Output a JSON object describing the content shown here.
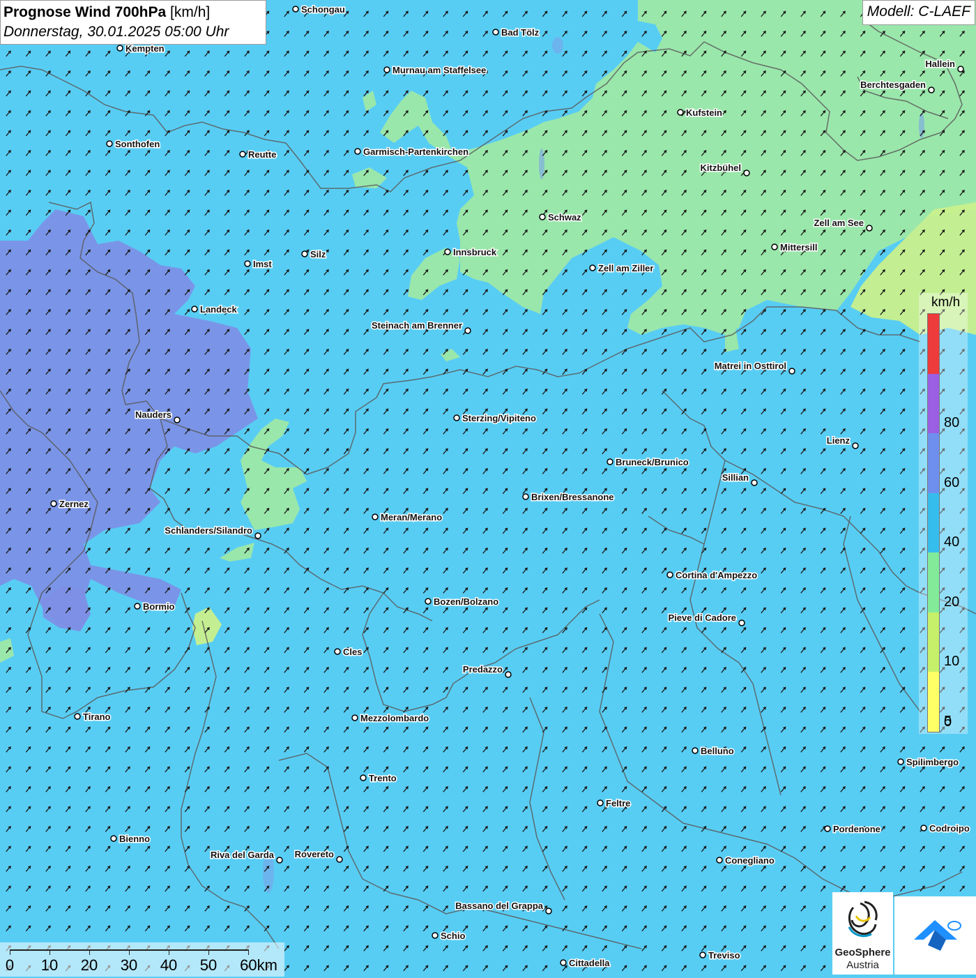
{
  "header": {
    "title_bold": "Prognose Wind 700hPa",
    "title_unit": "[km/h]",
    "datetime": "Donnerstag, 30.01.2025 05:00 Uhr"
  },
  "model": {
    "label": "Modell: C-LAEF"
  },
  "legend": {
    "unit": "km/h",
    "bins": [
      {
        "label": "",
        "color": "#ee3b3b"
      },
      {
        "label": "80",
        "color": "#9b5fe3"
      },
      {
        "label": "60",
        "color": "#6f8fef"
      },
      {
        "label": "40",
        "color": "#35bdee"
      },
      {
        "label": "20",
        "color": "#82eb9a"
      },
      {
        "label": "10",
        "color": "#c6f06a"
      },
      {
        "label": "5",
        "color": "#ffff66"
      }
    ],
    "bottom_label": "0"
  },
  "scale_bar": {
    "labels": [
      "0",
      "10",
      "20",
      "30",
      "40",
      "50",
      "60km"
    ]
  },
  "logos": {
    "geosphere_line1": "GeoSphere",
    "geosphere_line2": "Austria",
    "geosphere_icon": "geosphere-logo-icon",
    "app_icon": "wetter-app-logo-icon"
  },
  "colors": {
    "wind_20_40": "#58cdf4",
    "wind_10_20": "#9ee8a6",
    "wind_5_10": "#c9f08c",
    "wind_40_60": "#7c8fe6",
    "border": "#555555",
    "arrow": "#1a1a1a"
  },
  "cities": [
    {
      "name": "Schongau",
      "label_side": "right"
    },
    {
      "name": "Bad Tölz",
      "label_side": "right"
    },
    {
      "name": "Kempten",
      "label_side": "right"
    },
    {
      "name": "Murnau am Staffelsee",
      "label_side": "right"
    },
    {
      "name": "Hallein",
      "label_side": "left"
    },
    {
      "name": "Berchtesgaden",
      "label_side": "left"
    },
    {
      "name": "Kufstein",
      "label_side": "right"
    },
    {
      "name": "Sonthofen",
      "label_side": "right"
    },
    {
      "name": "Reutte",
      "label_side": "right"
    },
    {
      "name": "Garmisch-Partenkirchen",
      "label_side": "right"
    },
    {
      "name": "Kitzbühel",
      "label_side": "left"
    },
    {
      "name": "Schwaz",
      "label_side": "right"
    },
    {
      "name": "Zell am See",
      "label_side": "left"
    },
    {
      "name": "Innsbruck",
      "label_side": "right"
    },
    {
      "name": "Mittersill",
      "label_side": "right"
    },
    {
      "name": "Silz",
      "label_side": "right"
    },
    {
      "name": "Imst",
      "label_side": "right"
    },
    {
      "name": "Zell am Ziller",
      "label_side": "right"
    },
    {
      "name": "Landeck",
      "label_side": "right"
    },
    {
      "name": "Steinach am Brenner",
      "label_side": "left"
    },
    {
      "name": "Matrei in Osttirol",
      "label_side": "left"
    },
    {
      "name": "Nauders",
      "label_side": "left"
    },
    {
      "name": "Sterzing/Vipiteno",
      "label_side": "right"
    },
    {
      "name": "Lienz",
      "label_side": "left"
    },
    {
      "name": "Bruneck/Brunico",
      "label_side": "right"
    },
    {
      "name": "Sillian",
      "label_side": "left"
    },
    {
      "name": "Brixen/Bressanone",
      "label_side": "right"
    },
    {
      "name": "Zernez",
      "label_side": "right"
    },
    {
      "name": "Meran/Merano",
      "label_side": "right"
    },
    {
      "name": "Schlanders/Silandro",
      "label_side": "left"
    },
    {
      "name": "Cortina d'Ampezzo",
      "label_side": "right"
    },
    {
      "name": "Bozen/Bolzano",
      "label_side": "right"
    },
    {
      "name": "Bormio",
      "label_side": "right"
    },
    {
      "name": "Pieve di Cadore",
      "label_side": "left"
    },
    {
      "name": "Cles",
      "label_side": "right"
    },
    {
      "name": "Predazzo",
      "label_side": "left"
    },
    {
      "name": "Tirano",
      "label_side": "right"
    },
    {
      "name": "Mezzolombardo",
      "label_side": "right"
    },
    {
      "name": "Belluno",
      "label_side": "right"
    },
    {
      "name": "Spilimbergo",
      "label_side": "right"
    },
    {
      "name": "Trento",
      "label_side": "right"
    },
    {
      "name": "Feltre",
      "label_side": "right"
    },
    {
      "name": "Pordenone",
      "label_side": "right"
    },
    {
      "name": "Codroipo",
      "label_side": "right"
    },
    {
      "name": "Bienno",
      "label_side": "right"
    },
    {
      "name": "Riva del Garda",
      "label_side": "left"
    },
    {
      "name": "Rovereto",
      "label_side": "left"
    },
    {
      "name": "Conegliano",
      "label_side": "right"
    },
    {
      "name": "Bassano del Grappa",
      "label_side": "left"
    },
    {
      "name": "Schio",
      "label_side": "right"
    },
    {
      "name": "Treviso",
      "label_side": "right"
    },
    {
      "name": "Cittadella",
      "label_side": "right"
    }
  ]
}
